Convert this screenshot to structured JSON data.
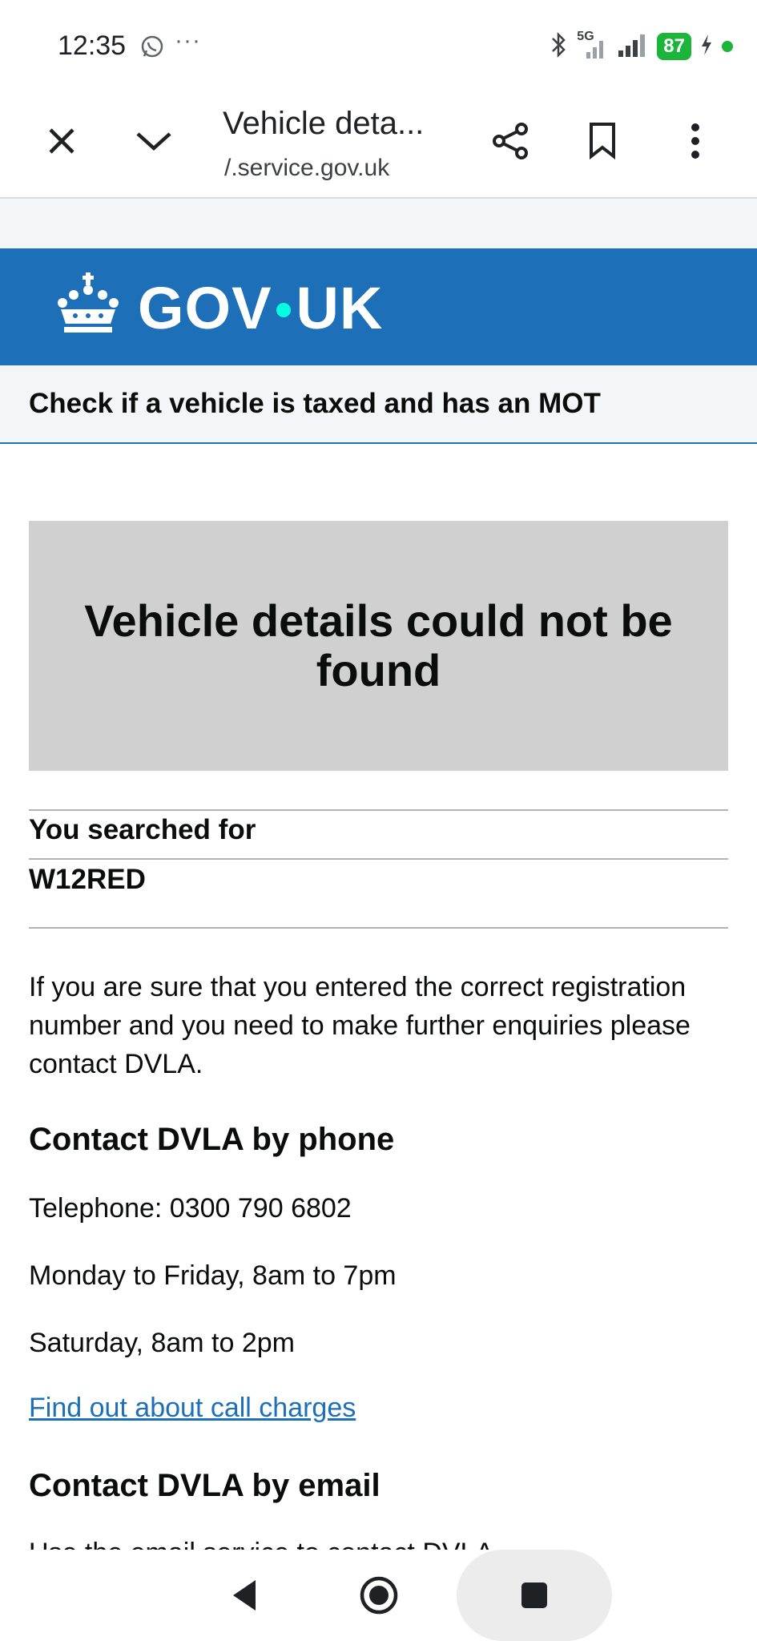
{
  "status_bar": {
    "time": "12:35",
    "network": "5G",
    "battery": "87"
  },
  "browser": {
    "tab_title": "Vehicle deta...",
    "url": "/.service.gov.uk"
  },
  "gov_header": {
    "logo_left": "GOV",
    "logo_right": "UK"
  },
  "service_name": "Check if a vehicle is taxed and has an MOT",
  "panel": {
    "title": "Vehicle details could not be found"
  },
  "summary": {
    "key": "You searched for",
    "value": "W12RED"
  },
  "content": {
    "intro": "If you are sure that you entered the correct registration number and you need to make further enquiries please contact DVLA.",
    "phone_heading": "Contact DVLA by phone",
    "telephone": "Telephone: 0300 790 6802",
    "weekday_hours": "Monday to Friday, 8am to 7pm",
    "saturday_hours": "Saturday, 8am to 2pm",
    "call_charges_link": "Find out about call charges",
    "email_heading": "Contact DVLA by email",
    "email_partial": "Use the email service to contact DVLA"
  },
  "colors": {
    "gov_blue": "#1d70b8",
    "panel_grey": "#d0d0d0",
    "link_blue": "#1d70b8",
    "battery_green": "#1bb53a"
  }
}
